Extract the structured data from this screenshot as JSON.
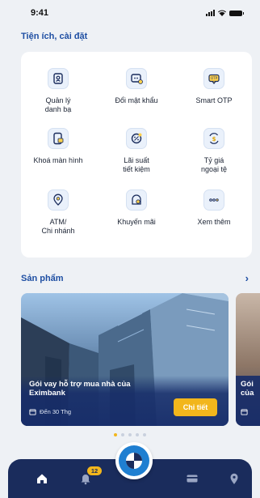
{
  "status": {
    "time": "9:41"
  },
  "utilities": {
    "title": "Tiện ích, cài đặt",
    "items": [
      {
        "label": "Quản lý\ndanh bạ",
        "icon": "contacts-icon"
      },
      {
        "label": "Đổi mật khẩu",
        "icon": "password-icon"
      },
      {
        "label": "Smart OTP",
        "icon": "otp-icon"
      },
      {
        "label": "Khoá màn hình",
        "icon": "lock-screen-icon"
      },
      {
        "label": "Lãi suất\ntiết kiệm",
        "icon": "interest-rate-icon"
      },
      {
        "label": "Tỷ giá\nngoại tệ",
        "icon": "exchange-rate-icon"
      },
      {
        "label": "ATM/\nChi nhánh",
        "icon": "atm-branch-icon"
      },
      {
        "label": "Khuyến mãi",
        "icon": "promotion-icon"
      },
      {
        "label": "Xem thêm",
        "icon": "more-icon"
      }
    ]
  },
  "products": {
    "title": "Sản phẩm",
    "more": "›",
    "banners": [
      {
        "title": "Gói vay hỗ trợ mua nhà của Eximbank",
        "date": "Đến 30 Thg",
        "button": "Chi tiết"
      },
      {
        "title": "Gói của"
      }
    ],
    "pages": 5,
    "active_page": 0
  },
  "tabbar": {
    "notification_count": "12",
    "items": [
      "home-icon",
      "bell-icon",
      "card-icon",
      "location-icon"
    ]
  },
  "colors": {
    "accent": "#1f4fa3",
    "tabbar": "#1a2c5c",
    "highlight": "#f2b61c"
  }
}
